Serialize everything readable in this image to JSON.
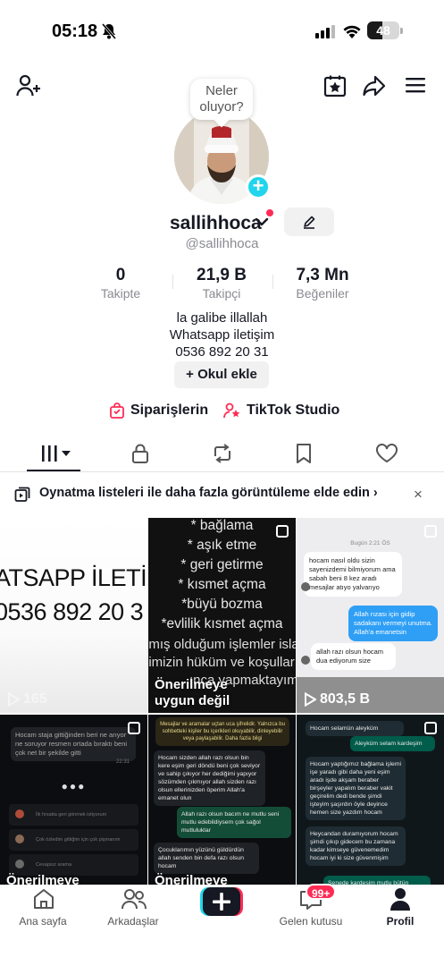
{
  "status_bar": {
    "time": "05:18",
    "battery": "48",
    "battery_level": 0.48
  },
  "header": {
    "bubble_text": "Neler oluyor?"
  },
  "profile": {
    "username": "sallihhoca",
    "handle": "@sallihhoca",
    "stats": [
      {
        "value": "0",
        "label": "Takipte"
      },
      {
        "value": "21,9 B",
        "label": "Takipçi"
      },
      {
        "value": "7,3 Mn",
        "label": "Beğeniler"
      }
    ],
    "bio": [
      "la galibe illallah",
      "Whatsapp iletişim",
      "0536 892 20 31"
    ],
    "add_school": "+ Okul ekle"
  },
  "links": {
    "orders": "Siparişlerin",
    "studio": "TikTok Studio"
  },
  "playlist_banner": {
    "text": "Oynatma listeleri ile daha fazla görüntüleme elde edin",
    "chevron": "›",
    "close": "×"
  },
  "videos": [
    {
      "line1": "ATSAPP İLETİ",
      "line2": "0536 892 20 3",
      "views": "165"
    },
    {
      "lines": [
        "* bağlama",
        "* aşık etme",
        "* geri getirme",
        "* kısmet açma",
        "*büyü bozma",
        "*evlilik kısmet açma"
      ],
      "bottom_lines": [
        "pmış olduğum işlemler isla",
        "nimizin hüküm ve koşulların",
        "ınca yapmaktayım"
      ],
      "overlay": [
        "Önerilmeye",
        "uygun değil"
      ]
    },
    {
      "date": "Bugün 2:21 ÖS",
      "msg1": "hocam nasıl oldu sizin sayenizdemi bilmiyorum ama sabah beni 8 kez aradı mesajlar atıyo yalvarıyo",
      "msg2": "Allah rızası için gidip sadakanı vermeyi unutma. Allah'a emanetsin",
      "msg3": "allah razı olsun hocam dua ediyorum size",
      "views": "803,5 B"
    },
    {
      "msg1": "Hocam staja gittiğinden beri ne arıyor ne soruyor resmen ortada bıraktı beni çok net bir şekilde gitti",
      "time1": "22:31",
      "dots": "●●●",
      "row1": "İlk fırsatta geri gönmek istiyorum",
      "row2": "Çok özledim gittiğim için çok pişmanım",
      "row3": "Cevapsız arama",
      "overlay": "Önerilmeye"
    },
    {
      "header": "Mesajlar ve aramalar uçtan uca şifrelidir. Yalnızca bu sohbetteki kişiler bu içerikleri okuyabilir, dinleyebilir veya paylaşabilir. Daha fazla bilgi",
      "msg1": "Hocam sizden allah razı olsun bin kere eşim geri döndü beni çok seviyor ve sahip çıkıyor her dediğimi yapıyor sözümden çıkmıyor allah sizden razı olsun ellerinizden öperim Allah'a emanet olun",
      "msg2": "Allah razı olsun bacım ne mutlu seni mutlu edebildiysem çok sağol mutluluklar",
      "msg3": "Çocuklarımın yüzünü güldürdün allah senden bin defa razı olsun hocam",
      "overlay": "Önerilmeye"
    },
    {
      "msg1": "Hocam selamün aleyküm",
      "msg2": "Aleyküm selam kardeşim",
      "msg3": "Hocam yaptığımız bağlama işlemi işe yaradı gibi daha yeni eşim aradı işde akşam beraber birşeyler yapalım beraber vakit geçirelim dedi bende şimdi işteyim şaşırdın öyle deyince hemen size yazdım hocam",
      "msg4": "Heycandan duramıyorum hocam şimdi çıkıp gidecem bu zamana kadar kimseye güvenemedim hocam iyi ki size güvenmişim",
      "msg5": "Senede kardeşim mutlu bütün"
    }
  ],
  "bottom_nav": {
    "home": "Ana sayfa",
    "friends": "Arkadaşlar",
    "inbox": "Gelen kutusu",
    "inbox_badge": "99+",
    "profile": "Profil"
  },
  "colors": {
    "accent": "#fe2c55",
    "cyan": "#20d5ec",
    "text": "#161823",
    "muted": "#8a8b91"
  }
}
